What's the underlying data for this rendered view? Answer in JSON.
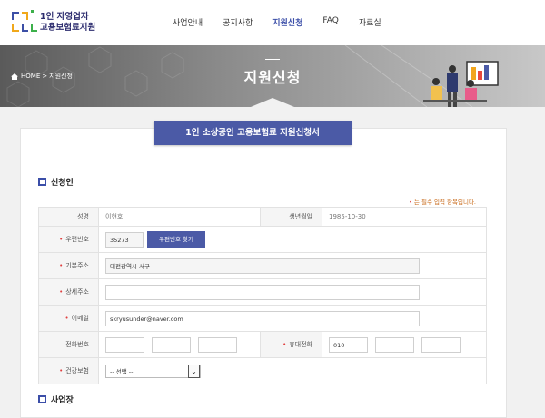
{
  "header": {
    "logo_line1": "1인 자영업자",
    "logo_line2": "고용보험료지원",
    "nav": [
      "사업안내",
      "공지사항",
      "지원신청",
      "FAQ",
      "자료실"
    ],
    "active_nav": "지원신청"
  },
  "hero": {
    "breadcrumb_home": "HOME",
    "breadcrumb_sep": ">",
    "breadcrumb_current": "지원신청",
    "title": "지원신청"
  },
  "form": {
    "banner": "1인 소상공인 고용보험료 지원신청서",
    "section_applicant": "신청인",
    "section_business": "사업장",
    "required_note": "는 필수 입력 항목입니다.",
    "required_mark": "•",
    "labels": {
      "name": "성명",
      "birth": "생년월일",
      "zip": "우편번호",
      "address": "기본주소",
      "address_detail": "상세주소",
      "email": "이메일",
      "phone": "전화번호",
      "mobile": "휴대전화",
      "insurance": "건강보험"
    },
    "values": {
      "name": "이현호",
      "birth": "1985-10-30",
      "zip": "35273",
      "address": "대전광역시 서구",
      "address_detail": "",
      "email": "skryusunder@naver.com",
      "phone1": "",
      "phone2": "",
      "phone3": "",
      "mobile1": "010",
      "mobile2": "",
      "mobile3": "",
      "insurance_selected": "-- 선택 --"
    },
    "zip_button": "우편번호 찾기",
    "dash": "-"
  },
  "colors": {
    "accent": "#4b5aa6",
    "required": "#e04040",
    "note": "#c86a1a"
  }
}
